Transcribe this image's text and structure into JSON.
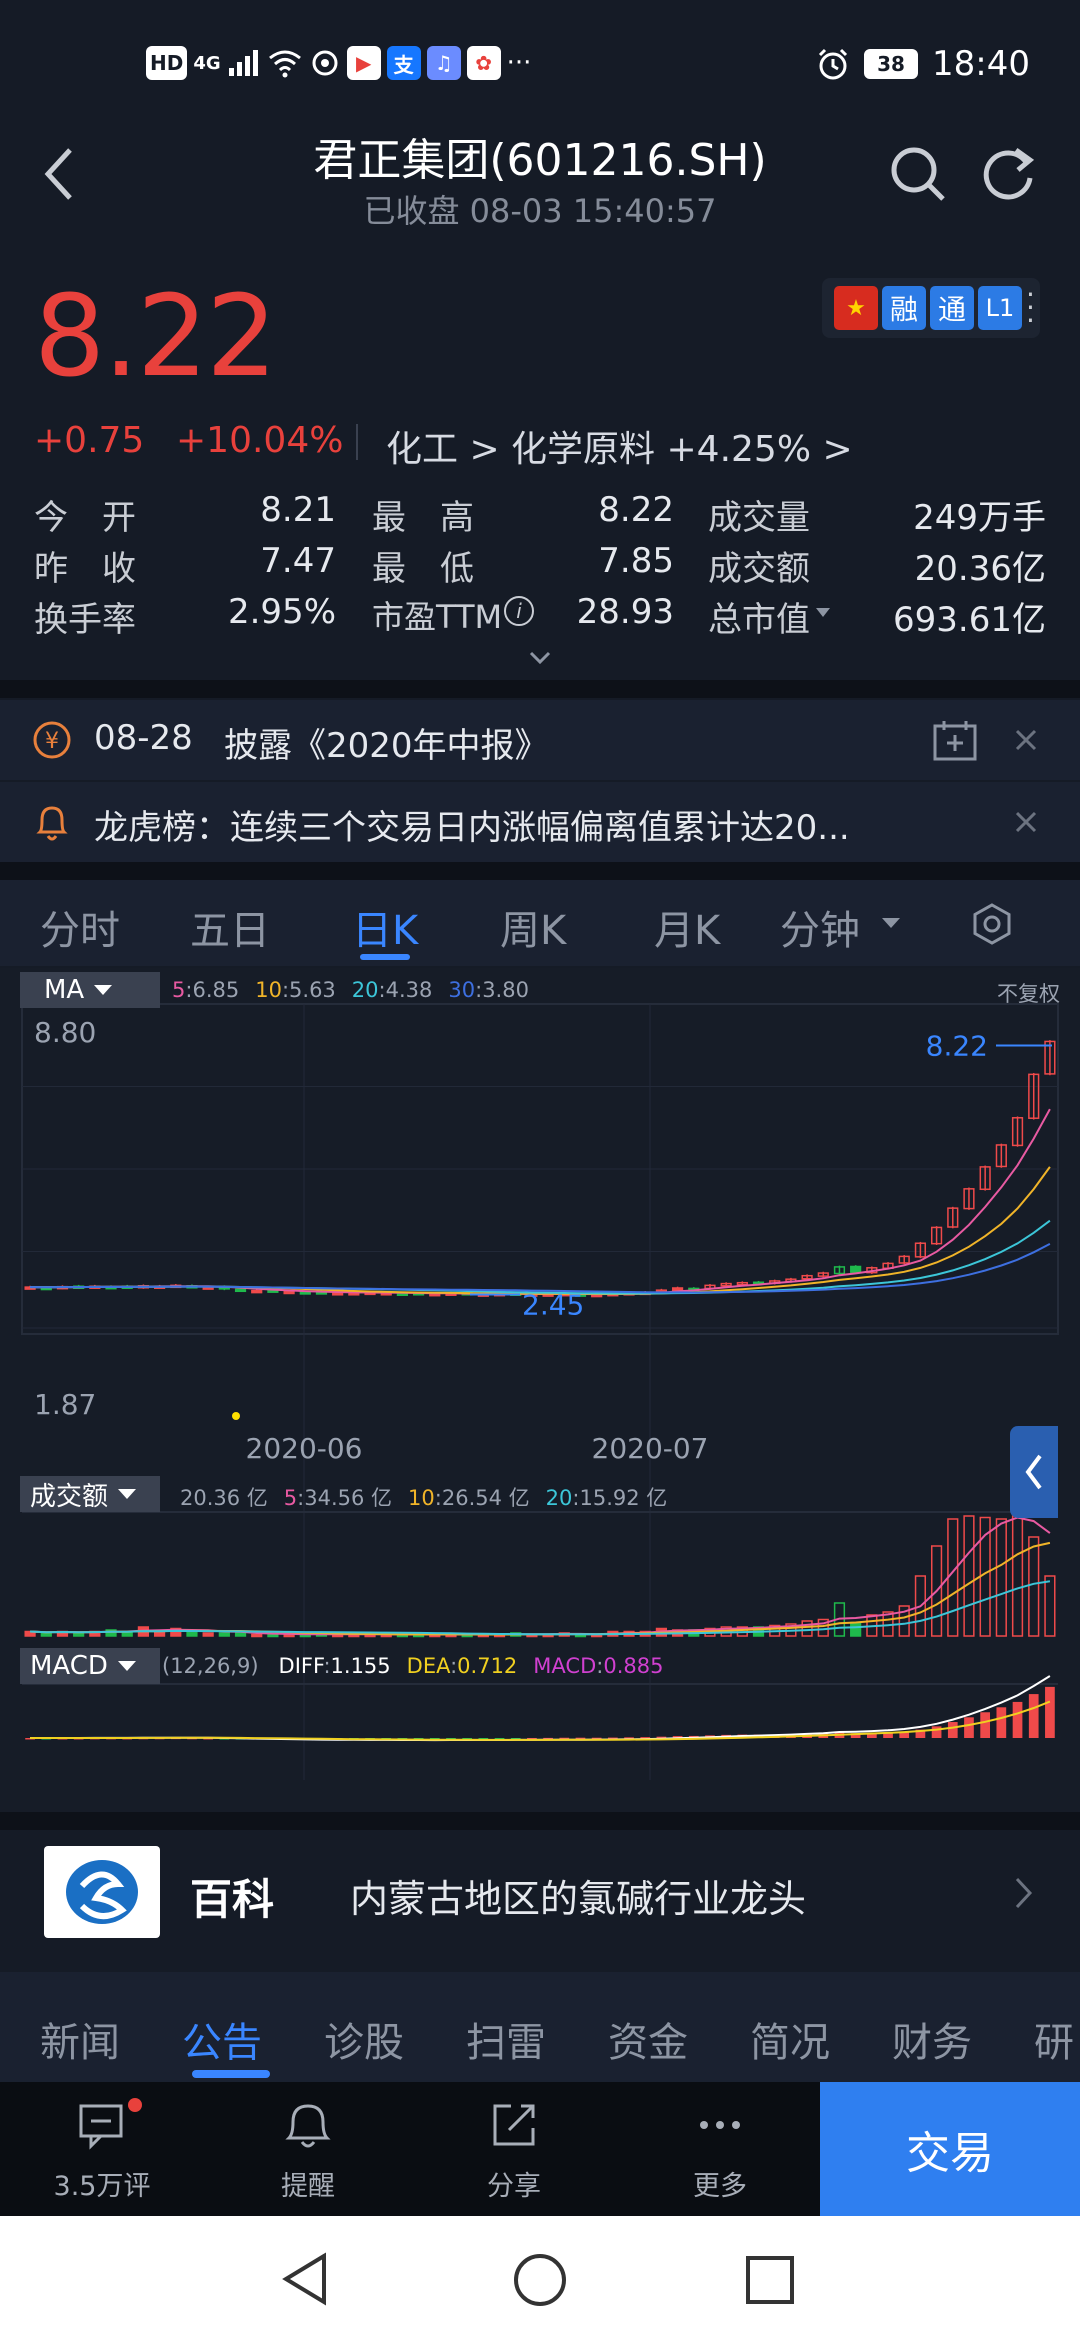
{
  "status": {
    "network": "4G",
    "time": "18:40",
    "battery": "38"
  },
  "header": {
    "title": "君正集团(601216.SH)",
    "subtitle": "已收盘 08-03 15:40:57"
  },
  "quote": {
    "price": "8.22",
    "change": "+0.75",
    "change_pct": "+10.04%",
    "industry": "化工 > 化学原料 +4.25% >",
    "badges": [
      "融",
      "通",
      "L1"
    ],
    "stats": [
      {
        "label": "今　开",
        "value": "8.21"
      },
      {
        "label": "最　高",
        "value": "8.22"
      },
      {
        "label": "成交量",
        "value": "249万手"
      },
      {
        "label": "昨　收",
        "value": "7.47"
      },
      {
        "label": "最　低",
        "value": "7.85"
      },
      {
        "label": "成交额",
        "value": "20.36亿"
      },
      {
        "label": "换手率",
        "value": "2.95%"
      },
      {
        "label": "市盈TTM",
        "value": "28.93"
      },
      {
        "label": "总市值",
        "value": "693.61亿"
      }
    ]
  },
  "notices": [
    {
      "date": "08-28",
      "text": "披露《2020年中报》"
    },
    {
      "text": "龙虎榜：连续三个交易日内涨幅偏离值累计达20..."
    }
  ],
  "chart_tabs": [
    "分时",
    "五日",
    "日K",
    "周K",
    "月K",
    "分钟"
  ],
  "chart_tabs_active": "日K",
  "chart_labels": {
    "ma_chip": "MA",
    "adjust": "不复权",
    "vol_chip": "成交额",
    "macd_chip": "MACD",
    "macd_params": "(12,26,9)"
  },
  "chart_data": {
    "type": "candlestick",
    "x_ticks": [
      "2020-06",
      "2020-07"
    ],
    "price_axis": {
      "max_label": "8.80",
      "min_label": "1.87"
    },
    "annotations": {
      "last_price": "8.22",
      "low_price": "2.45"
    },
    "ma_legend": [
      {
        "name": "5",
        "value": "6.85",
        "color": "#e85aa2"
      },
      {
        "name": "10",
        "value": "5.63",
        "color": "#f0b429"
      },
      {
        "name": "20",
        "value": "4.38",
        "color": "#3cc6d8"
      },
      {
        "name": "30",
        "value": "3.80",
        "color": "#3d6fe0"
      }
    ],
    "volume_legend": [
      {
        "name": "",
        "value": "20.36 亿",
        "color": "#9ba3b1"
      },
      {
        "name": "5",
        "value": "34.56 亿",
        "color": "#e85aa2"
      },
      {
        "name": "10",
        "value": "26.54 亿",
        "color": "#f0b429"
      },
      {
        "name": "20",
        "value": "15.92 亿",
        "color": "#3cc6d8"
      }
    ],
    "macd_legend": [
      {
        "name": "DIFF",
        "value": "1.155",
        "color": "#ffffff"
      },
      {
        "name": "DEA",
        "value": "0.712",
        "color": "#f0d020"
      },
      {
        "name": "MACD",
        "value": "0.885",
        "color": "#d040d0"
      }
    ],
    "closes": [
      2.62,
      2.61,
      2.63,
      2.62,
      2.64,
      2.63,
      2.62,
      2.65,
      2.64,
      2.66,
      2.63,
      2.62,
      2.58,
      2.55,
      2.54,
      2.53,
      2.52,
      2.5,
      2.5,
      2.49,
      2.49,
      2.5,
      2.49,
      2.48,
      2.47,
      2.47,
      2.48,
      2.46,
      2.46,
      2.47,
      2.46,
      2.46,
      2.46,
      2.47,
      2.46,
      2.45,
      2.47,
      2.49,
      2.5,
      2.55,
      2.6,
      2.58,
      2.66,
      2.7,
      2.72,
      2.72,
      2.76,
      2.8,
      2.88,
      2.94,
      3.08,
      2.96,
      3.06,
      3.16,
      3.32,
      3.62,
      3.98,
      4.42,
      4.86,
      5.36,
      5.86,
      6.48,
      7.47,
      8.22
    ],
    "volumes": [
      3,
      2,
      3,
      2,
      3,
      4,
      3,
      6,
      3,
      5,
      3,
      2,
      2,
      2,
      1,
      1,
      1,
      1,
      2,
      1,
      1,
      1,
      1,
      1,
      1,
      1,
      1,
      1,
      1,
      1,
      2,
      1,
      1,
      2,
      1,
      1,
      3,
      3,
      3,
      5,
      4,
      4,
      5,
      6,
      6,
      6,
      7,
      8,
      10,
      11,
      22,
      9,
      14,
      16,
      20,
      40,
      60,
      78,
      80,
      79,
      78,
      80,
      66,
      40
    ]
  },
  "baike": {
    "title": "百科",
    "text": "内蒙古地区的氯碱行业龙头"
  },
  "news_tabs": [
    "新闻",
    "公告",
    "诊股",
    "扫雷",
    "资金",
    "简况",
    "财务",
    "研"
  ],
  "news_tabs_active": "公告",
  "toolbar": {
    "comments": "3.5万评",
    "remind": "提醒",
    "share": "分享",
    "more": "更多",
    "trade": "交易"
  }
}
